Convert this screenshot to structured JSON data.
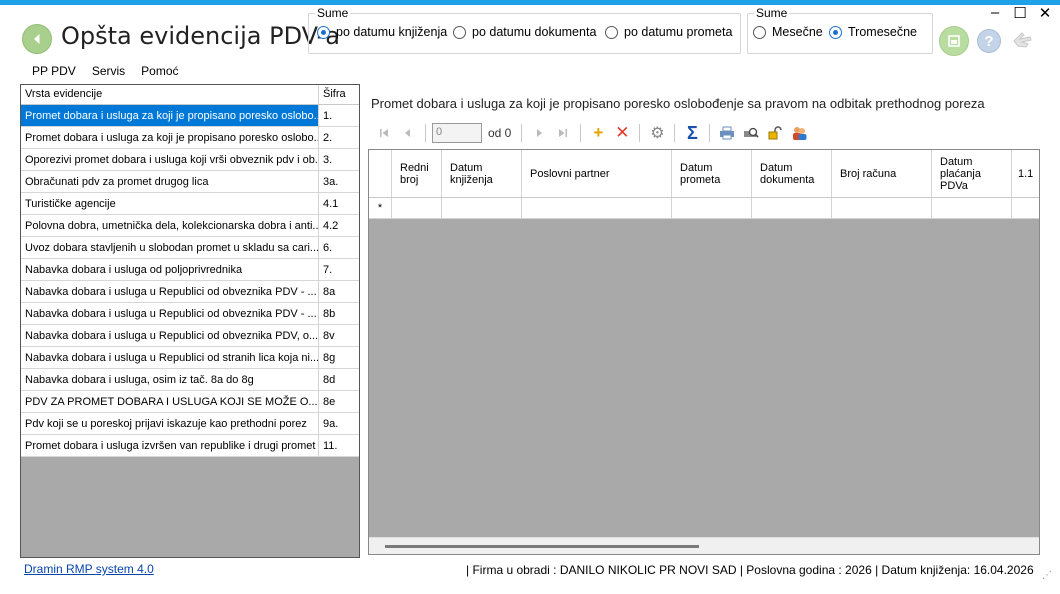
{
  "window": {
    "title": "Opšta evidencija PDV-a",
    "controls": {
      "minimize": "–",
      "maximize": "☐",
      "close": "✕"
    }
  },
  "sume_group_1": {
    "legend": "Sume",
    "options": [
      "po datumu knjiženja",
      "po datumu dokumenta",
      "po datumu prometa"
    ],
    "selected": "po datumu knjiženja"
  },
  "sume_group_2": {
    "legend": "Sume",
    "options": [
      "Mesečne",
      "Tromesečne"
    ],
    "selected": "Tromesečne"
  },
  "menu": [
    "PP PDV",
    "Servis",
    "Pomoć"
  ],
  "evidencije": {
    "headers": {
      "name": "Vrsta evidencije",
      "code": "Šifra"
    },
    "rows": [
      {
        "name": "Promet dobara i usluga za koji je propisano poresko oslobo...",
        "code": "1."
      },
      {
        "name": "Promet dobara i usluga za koji je propisano poresko oslobo...",
        "code": "2."
      },
      {
        "name": "Oporezivi promet dobara i usluga koji vrši obveznik pdv i ob...",
        "code": "3."
      },
      {
        "name": "Obračunati pdv za promet drugog lica",
        "code": "3a."
      },
      {
        "name": "Turističke agencije",
        "code": "4.1"
      },
      {
        "name": "Polovna dobra, umetnička dela, kolekcionarska dobra i anti...",
        "code": "4.2"
      },
      {
        "name": "Uvoz dobara stavljenih u slobodan promet u skladu sa cari...",
        "code": "6."
      },
      {
        "name": "Nabavka dobara i usluga od poljoprivrednika",
        "code": "7."
      },
      {
        "name": "Nabavka dobara i usluga u Republici od obveznika PDV - ...",
        "code": "8a"
      },
      {
        "name": "Nabavka dobara i usluga u Republici od obveznika PDV - ...",
        "code": "8b"
      },
      {
        "name": "Nabavka dobara i usluga u Republici od obveznika PDV, o...",
        "code": "8v"
      },
      {
        "name": "Nabavka dobara i usluga u Republici od stranih lica koja ni...",
        "code": "8g"
      },
      {
        "name": "Nabavka dobara i usluga, osim iz tač. 8a do 8g",
        "code": "8d"
      },
      {
        "name": "PDV ZA PROMET DOBARA I USLUGA KOJI SE MOŽE O...",
        "code": "8e"
      },
      {
        "name": "Pdv koji se u poreskoj prijavi iskazuje kao prethodni porez",
        "code": "9a."
      },
      {
        "name": "Promet dobara i usluga izvršen van republike i drugi promet ...",
        "code": "11."
      }
    ],
    "selected_index": 0
  },
  "detail": {
    "title": "Promet dobara i usluga za koji je propisano poresko oslobođenje sa pravom na odbitak prethodnog poreza",
    "navigator": {
      "position": "0",
      "of_label": "od 0"
    },
    "columns": [
      "Redni broj",
      "Datum knjiženja",
      "Poslovni partner",
      "Datum prometa",
      "Datum dokumenta",
      "Broj računa",
      "Datum plaćanja PDVa",
      "1.1"
    ],
    "new_row_marker": "*"
  },
  "status": {
    "link": "Dramin RMP system 4.0",
    "text": "|  Firma u obradi : DANILO NIKOLIC PR NOVI SAD  |  Poslovna godina : 2026  |  Datum knjiženja: 16.04.2026"
  },
  "colors": {
    "accent": "#1ea1e6",
    "selection": "#0078d7",
    "grid_bg": "#a9a9a9"
  }
}
